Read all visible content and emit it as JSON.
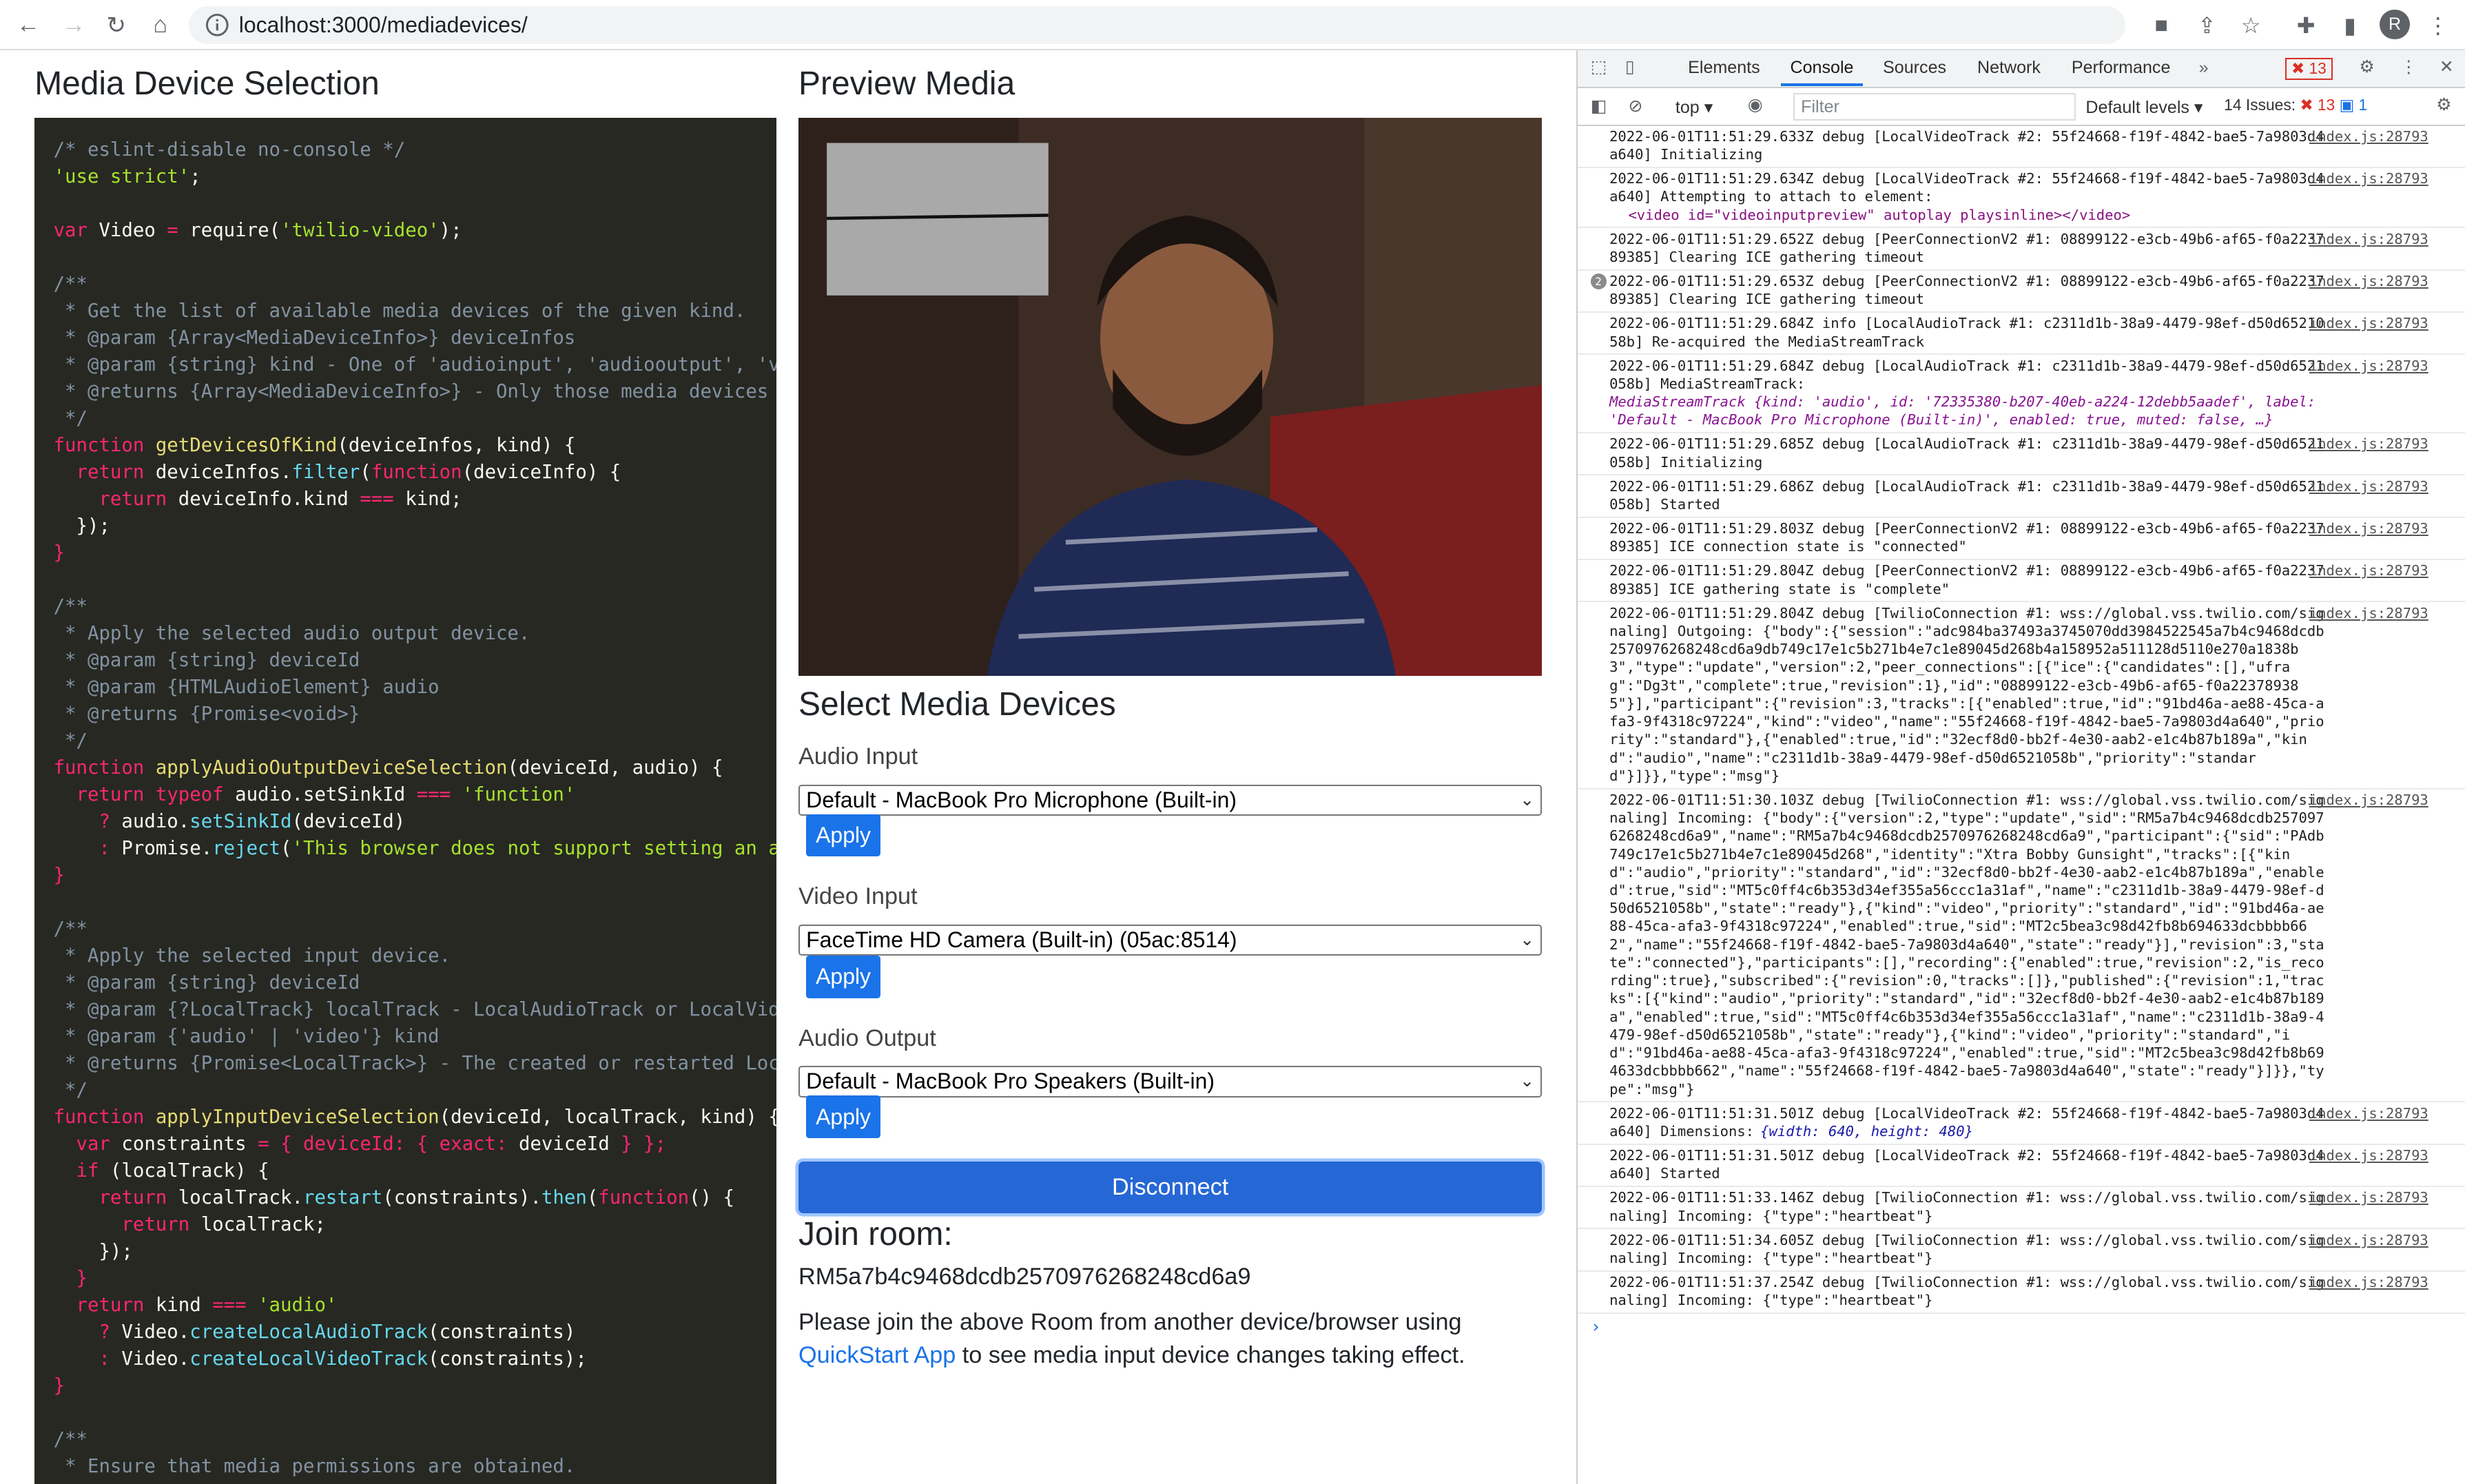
{
  "browser": {
    "url": "localhost:3000/mediadevices/",
    "profile_initial": "R"
  },
  "page": {
    "left_title": "Media Device Selection",
    "preview_title": "Preview Media",
    "select_title": "Select Media Devices",
    "audio_input_label": "Audio Input",
    "audio_input_value": "Default - MacBook Pro Microphone (Built-in)",
    "video_input_label": "Video Input",
    "video_input_value": "FaceTime HD Camera (Built-in) (05ac:8514)",
    "audio_output_label": "Audio Output",
    "audio_output_value": "Default - MacBook Pro Speakers (Built-in)",
    "apply_label": "Apply",
    "disconnect_label": "Disconnect",
    "join_title": "Join room:",
    "room_name": "RM5a7b4c9468dcdb2570976268248cd6a9",
    "join_text_1": "Please join the above Room from another device/browser using ",
    "join_link": "QuickStart App",
    "join_text_2": " to see media input device changes taking effect."
  },
  "code_lines": [
    [
      [
        "cm",
        "/* eslint-disable no-console */"
      ]
    ],
    [
      [
        "st",
        "'use strict'"
      ],
      [
        "pn",
        ";"
      ]
    ],
    [],
    [
      [
        "kw",
        "var"
      ],
      [
        "nm",
        " Video "
      ],
      [
        "kw",
        "="
      ],
      [
        "nm",
        " require"
      ],
      [
        "pn",
        "("
      ],
      [
        "st",
        "'twilio-video'"
      ],
      [
        "pn",
        ");"
      ]
    ],
    [],
    [
      [
        "cm",
        "/**"
      ]
    ],
    [
      [
        "cm",
        " * Get the list of available media devices of the given kind."
      ]
    ],
    [
      [
        "cm",
        " * @param {Array<MediaDeviceInfo>} deviceInfos"
      ]
    ],
    [
      [
        "cm",
        " * @param {string} kind - One of 'audioinput', 'audiooutput', 'videoinput'"
      ]
    ],
    [
      [
        "cm",
        " * @returns {Array<MediaDeviceInfo>} - Only those media devices of the given kind"
      ]
    ],
    [
      [
        "cm",
        " */"
      ]
    ],
    [
      [
        "kw",
        "function"
      ],
      [
        "fn",
        " getDevicesOfKind"
      ],
      [
        "pn",
        "("
      ],
      [
        "nm",
        "deviceInfos, kind"
      ],
      [
        "pn",
        ") {"
      ]
    ],
    [
      [
        "kw",
        "  return"
      ],
      [
        "nm",
        " deviceInfos"
      ],
      [
        "pn",
        "."
      ],
      [
        "pr",
        "filter"
      ],
      [
        "pn",
        "("
      ],
      [
        "kw",
        "function"
      ],
      [
        "pn",
        "("
      ],
      [
        "nm",
        "deviceInfo"
      ],
      [
        "pn",
        ") {"
      ]
    ],
    [
      [
        "kw",
        "    return"
      ],
      [
        "nm",
        " deviceInfo"
      ],
      [
        "pn",
        "."
      ],
      [
        "nm",
        "kind "
      ],
      [
        "kw",
        "==="
      ],
      [
        "nm",
        " kind"
      ],
      [
        "pn",
        ";"
      ]
    ],
    [
      [
        "pn",
        "  });"
      ]
    ],
    [
      [
        "kw",
        "}"
      ]
    ],
    [],
    [
      [
        "cm",
        "/**"
      ]
    ],
    [
      [
        "cm",
        " * Apply the selected audio output device."
      ]
    ],
    [
      [
        "cm",
        " * @param {string} deviceId"
      ]
    ],
    [
      [
        "cm",
        " * @param {HTMLAudioElement} audio"
      ]
    ],
    [
      [
        "cm",
        " * @returns {Promise<void>}"
      ]
    ],
    [
      [
        "cm",
        " */"
      ]
    ],
    [
      [
        "kw",
        "function"
      ],
      [
        "fn",
        " applyAudioOutputDeviceSelection"
      ],
      [
        "pn",
        "("
      ],
      [
        "nm",
        "deviceId, audio"
      ],
      [
        "pn",
        ") {"
      ]
    ],
    [
      [
        "kw",
        "  return typeof"
      ],
      [
        "nm",
        " audio"
      ],
      [
        "pn",
        "."
      ],
      [
        "nm",
        "setSinkId "
      ],
      [
        "kw",
        "==="
      ],
      [
        "st",
        " 'function'"
      ]
    ],
    [
      [
        "kw",
        "    ?"
      ],
      [
        "nm",
        " audio"
      ],
      [
        "pn",
        "."
      ],
      [
        "pr",
        "setSinkId"
      ],
      [
        "pn",
        "("
      ],
      [
        "nm",
        "deviceId"
      ],
      [
        "pn",
        ")"
      ]
    ],
    [
      [
        "kw",
        "    :"
      ],
      [
        "nm",
        " Promise"
      ],
      [
        "pn",
        "."
      ],
      [
        "pr",
        "reject"
      ],
      [
        "pn",
        "("
      ],
      [
        "st",
        "'This browser does not support setting an audio output device'"
      ],
      [
        "pn",
        ");"
      ]
    ],
    [
      [
        "kw",
        "}"
      ]
    ],
    [],
    [
      [
        "cm",
        "/**"
      ]
    ],
    [
      [
        "cm",
        " * Apply the selected input device."
      ]
    ],
    [
      [
        "cm",
        " * @param {string} deviceId"
      ]
    ],
    [
      [
        "cm",
        " * @param {?LocalTrack} localTrack - LocalAudioTrack or LocalVideoTrack"
      ]
    ],
    [
      [
        "cm",
        " * @param {'audio' | 'video'} kind"
      ]
    ],
    [
      [
        "cm",
        " * @returns {Promise<LocalTrack>} - The created or restarted LocalTrack"
      ]
    ],
    [
      [
        "cm",
        " */"
      ]
    ],
    [
      [
        "kw",
        "function"
      ],
      [
        "fn",
        " applyInputDeviceSelection"
      ],
      [
        "pn",
        "("
      ],
      [
        "nm",
        "deviceId, localTrack, kind"
      ],
      [
        "pn",
        ") {"
      ]
    ],
    [
      [
        "kw",
        "  var"
      ],
      [
        "nm",
        " constraints "
      ],
      [
        "kw",
        "="
      ],
      [
        "kw",
        " { deviceId: { exact:"
      ],
      [
        "nm",
        " deviceId "
      ],
      [
        "kw",
        "} };"
      ]
    ],
    [
      [
        "kw",
        "  if"
      ],
      [
        "pn",
        " ("
      ],
      [
        "nm",
        "localTrack"
      ],
      [
        "pn",
        ") {"
      ]
    ],
    [
      [
        "kw",
        "    return"
      ],
      [
        "nm",
        " localTrack"
      ],
      [
        "pn",
        "."
      ],
      [
        "pr",
        "restart"
      ],
      [
        "pn",
        "("
      ],
      [
        "nm",
        "constraints"
      ],
      [
        "pn",
        ")."
      ],
      [
        "pr",
        "then"
      ],
      [
        "pn",
        "("
      ],
      [
        "kw",
        "function"
      ],
      [
        "pn",
        "() {"
      ]
    ],
    [
      [
        "kw",
        "      return"
      ],
      [
        "nm",
        " localTrack"
      ],
      [
        "pn",
        ";"
      ]
    ],
    [
      [
        "pn",
        "    });"
      ]
    ],
    [
      [
        "kw",
        "  }"
      ]
    ],
    [
      [
        "kw",
        "  return"
      ],
      [
        "nm",
        " kind "
      ],
      [
        "kw",
        "==="
      ],
      [
        "st",
        " 'audio'"
      ]
    ],
    [
      [
        "kw",
        "    ?"
      ],
      [
        "nm",
        " Video"
      ],
      [
        "pn",
        "."
      ],
      [
        "pr",
        "createLocalAudioTrack"
      ],
      [
        "pn",
        "("
      ],
      [
        "nm",
        "constraints"
      ],
      [
        "pn",
        ")"
      ]
    ],
    [
      [
        "kw",
        "    :"
      ],
      [
        "nm",
        " Video"
      ],
      [
        "pn",
        "."
      ],
      [
        "pr",
        "createLocalVideoTrack"
      ],
      [
        "pn",
        "("
      ],
      [
        "nm",
        "constraints"
      ],
      [
        "pn",
        ");"
      ]
    ],
    [
      [
        "kw",
        "}"
      ]
    ],
    [],
    [
      [
        "cm",
        "/**"
      ]
    ],
    [
      [
        "cm",
        " * Ensure that media permissions are obtained."
      ]
    ]
  ],
  "devtools": {
    "tabs": [
      "Elements",
      "Console",
      "Sources",
      "Network",
      "Performance"
    ],
    "active_tab": "Console",
    "error_count": "13",
    "context": "top",
    "filter_placeholder": "Filter",
    "levels": "Default levels",
    "issues_label": "14 Issues:",
    "issues_errors": "13",
    "issues_info": "1",
    "source": "index.js:28793",
    "logs": [
      {
        "text": "2022-06-01T11:51:29.633Z debug [LocalVideoTrack #2: 55f24668-f19f-4842-bae5-7a9803d4a640] Initializing"
      },
      {
        "text": "2022-06-01T11:51:29.634Z debug [LocalVideoTrack #2: 55f24668-f19f-4842-bae5-7a9803d4a640] Attempting to attach to element:",
        "html": "<video id=\"videoinputpreview\" autoplay playsinline></video>"
      },
      {
        "text": "2022-06-01T11:51:29.652Z debug [PeerConnectionV2 #1: 08899122-e3cb-49b6-af65-f0a223789385] Clearing ICE gathering timeout"
      },
      {
        "text": "2022-06-01T11:51:29.653Z debug [PeerConnectionV2 #1: 08899122-e3cb-49b6-af65-f0a223789385] Clearing ICE gathering timeout",
        "badge": "2"
      },
      {
        "text": "2022-06-01T11:51:29.684Z info [LocalAudioTrack #1: c2311d1b-38a9-4479-98ef-d50d6521058b] Re-acquired the MediaStreamTrack"
      },
      {
        "text": "2022-06-01T11:51:29.684Z debug [LocalAudioTrack #1: c2311d1b-38a9-4479-98ef-d50d6521058b] MediaStreamTrack:",
        "obj": true
      },
      {
        "text": "2022-06-01T11:51:29.685Z debug [LocalAudioTrack #1: c2311d1b-38a9-4479-98ef-d50d6521058b] Initializing"
      },
      {
        "text": "2022-06-01T11:51:29.686Z debug [LocalAudioTrack #1: c2311d1b-38a9-4479-98ef-d50d6521058b] Started"
      },
      {
        "text": "2022-06-01T11:51:29.803Z debug [PeerConnectionV2 #1: 08899122-e3cb-49b6-af65-f0a223789385] ICE connection state is \"connected\""
      },
      {
        "text": "2022-06-01T11:51:29.804Z debug [PeerConnectionV2 #1: 08899122-e3cb-49b6-af65-f0a223789385] ICE gathering state is \"complete\""
      },
      {
        "text": "2022-06-01T11:51:29.804Z debug [TwilioConnection #1: wss://global.vss.twilio.com/signaling] Outgoing: {\"body\":{\"session\":\"adc984ba37493a3745070dd3984522545a7b4c9468dcdb2570976268248cd6a9db749c17e1c5b271b4e7c1e89045d268b4a158952a511128d5110e270a1838b3\",\"type\":\"update\",\"version\":2,\"peer_connections\":[{\"ice\":{\"candidates\":[],\"ufrag\":\"Dg3t\",\"complete\":true,\"revision\":1},\"id\":\"08899122-e3cb-49b6-af65-f0a223789385\"}],\"participant\":{\"revision\":3,\"tracks\":[{\"enabled\":true,\"id\":\"91bd46a-ae88-45ca-afa3-9f4318c97224\",\"kind\":\"video\",\"name\":\"55f24668-f19f-4842-bae5-7a9803d4a640\",\"priority\":\"standard\"},{\"enabled\":true,\"id\":\"32ecf8d0-bb2f-4e30-aab2-e1c4b87b189a\",\"kind\":\"audio\",\"name\":\"c2311d1b-38a9-4479-98ef-d50d6521058b\",\"priority\":\"standard\"}]}},\"type\":\"msg\"}"
      },
      {
        "text": "2022-06-01T11:51:30.103Z debug [TwilioConnection #1: wss://global.vss.twilio.com/signaling] Incoming: {\"body\":{\"version\":2,\"type\":\"update\",\"sid\":\"RM5a7b4c9468dcdb2570976268248cd6a9\",\"name\":\"RM5a7b4c9468dcdb2570976268248cd6a9\",\"participant\":{\"sid\":\"PAdb749c17e1c5b271b4e7c1e89045d268\",\"identity\":\"Xtra Bobby Gunsight\",\"tracks\":[{\"kind\":\"audio\",\"priority\":\"standard\",\"id\":\"32ecf8d0-bb2f-4e30-aab2-e1c4b87b189a\",\"enabled\":true,\"sid\":\"MT5c0ff4c6b353d34ef355a56ccc1a31af\",\"name\":\"c2311d1b-38a9-4479-98ef-d50d6521058b\",\"state\":\"ready\"},{\"kind\":\"video\",\"priority\":\"standard\",\"id\":\"91bd46a-ae88-45ca-afa3-9f4318c97224\",\"enabled\":true,\"sid\":\"MT2c5bea3c98d42fb8b694633dcbbbb662\",\"name\":\"55f24668-f19f-4842-bae5-7a9803d4a640\",\"state\":\"ready\"}],\"revision\":3,\"state\":\"connected\"},\"participants\":[],\"recording\":{\"enabled\":true,\"revision\":2,\"is_recording\":true},\"subscribed\":{\"revision\":0,\"tracks\":[]},\"published\":{\"revision\":1,\"tracks\":[{\"kind\":\"audio\",\"priority\":\"standard\",\"id\":\"32ecf8d0-bb2f-4e30-aab2-e1c4b87b189a\",\"enabled\":true,\"sid\":\"MT5c0ff4c6b353d34ef355a56ccc1a31af\",\"name\":\"c2311d1b-38a9-4479-98ef-d50d6521058b\",\"state\":\"ready\"},{\"kind\":\"video\",\"priority\":\"standard\",\"id\":\"91bd46a-ae88-45ca-afa3-9f4318c97224\",\"enabled\":true,\"sid\":\"MT2c5bea3c98d42fb8b694633dcbbbb662\",\"name\":\"55f24668-f19f-4842-bae5-7a9803d4a640\",\"state\":\"ready\"}]}},\"type\":\"msg\"}"
      },
      {
        "text": "2022-06-01T11:51:31.501Z debug [LocalVideoTrack #2: 55f24668-f19f-4842-bae5-7a9803d4a640] Dimensions:",
        "dims": "{width: 640, height: 480}"
      },
      {
        "text": "2022-06-01T11:51:31.501Z debug [LocalVideoTrack #2: 55f24668-f19f-4842-bae5-7a9803d4a640] Started"
      },
      {
        "text": "2022-06-01T11:51:33.146Z debug [TwilioConnection #1: wss://global.vss.twilio.com/signaling] Incoming: {\"type\":\"heartbeat\"}"
      },
      {
        "text": "2022-06-01T11:51:34.605Z debug [TwilioConnection #1: wss://global.vss.twilio.com/signaling] Incoming: {\"type\":\"heartbeat\"}"
      },
      {
        "text": "2022-06-01T11:51:37.254Z debug [TwilioConnection #1: wss://global.vss.twilio.com/signaling] Incoming: {\"type\":\"heartbeat\"}"
      }
    ],
    "obj_preview": "MediaStreamTrack {kind: 'audio', id: '72335380-b207-40eb-a224-12debb5aadef', label: 'Default - MacBook Pro Microphone (Built-in)', enabled: true, muted: false, …}"
  },
  "colors": {
    "accent": "#1a73e8",
    "code_bg": "#272822",
    "disconnect": "#2567d5"
  }
}
